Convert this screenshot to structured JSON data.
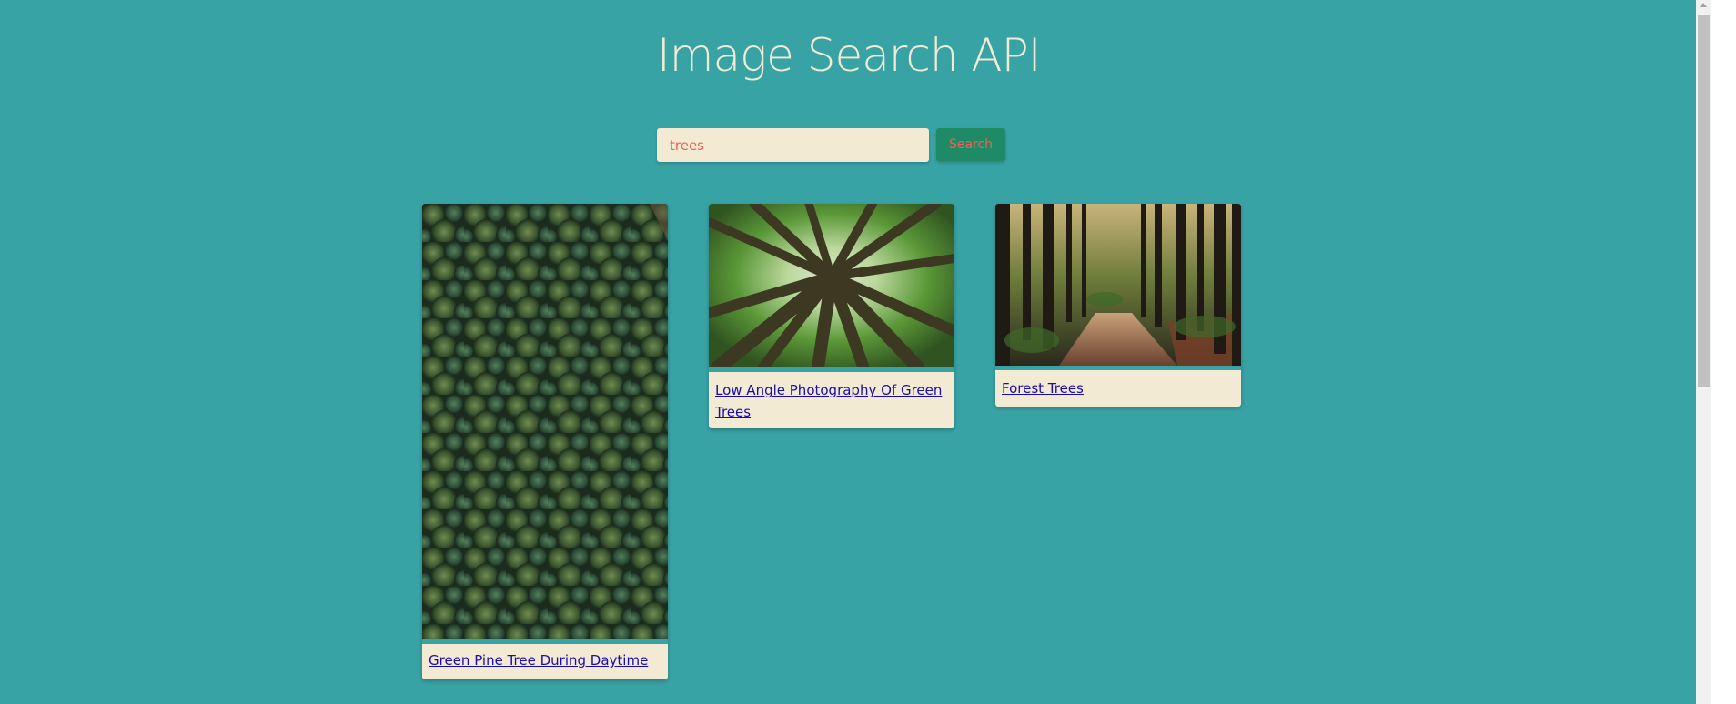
{
  "header": {
    "title": "Image Search API"
  },
  "search": {
    "value": "trees",
    "button_label": "Search"
  },
  "results": [
    {
      "title": "Green Pine Tree During Daytime",
      "image_icon": "aerial-pine-forest-image"
    },
    {
      "title": "Low Angle Photography Of Green Trees",
      "image_icon": "low-angle-trees-image"
    },
    {
      "title": "Forest Trees",
      "image_icon": "forest-path-image"
    }
  ],
  "colors": {
    "background": "#38a3a5",
    "card": "#f2ead3",
    "accent_text": "#ee6352",
    "button": "#1f8a66",
    "link": "#1a0dab"
  }
}
